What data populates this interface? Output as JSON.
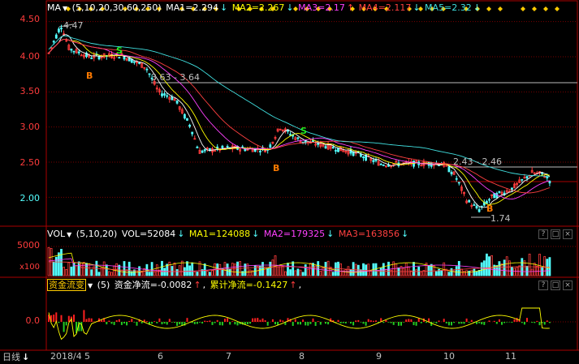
{
  "colors": {
    "up": "#ff3c3c",
    "down": "#54ffff",
    "ma1": "#ffffff",
    "ma2": "#ffff00",
    "ma3": "#ff40ff",
    "ma4": "#ff4040",
    "ma5": "#40e0e0",
    "grid": "#7a0000",
    "axis": "#aa0000",
    "flow_pos": "#ff2020",
    "flow_neg": "#22cc22",
    "flow_line": "#ffff00",
    "marker": "#ffcc00"
  },
  "price_panel": {
    "indicator_name": "MA",
    "params": "(5,10,20,30,60,250)",
    "ma1": {
      "label": "MA1=2.294",
      "arrow": "↓"
    },
    "ma2": {
      "label": "MA2=2.267",
      "arrow": "↓"
    },
    "ma3": {
      "label": "MA3=2.17",
      "arrow": "↑"
    },
    "ma4": {
      "label": "MA4=2.117",
      "arrow": "↓"
    },
    "ma5": {
      "label": "MA5=2.32",
      "arrow": "↓"
    },
    "y_ticks": [
      "4.50",
      "4.00",
      "3.50",
      "3.00",
      "2.50",
      "2.00"
    ],
    "annotations": {
      "high": "4.47",
      "level1": "3.63 - 3.64",
      "level2": "2.43 - 2.46",
      "low": "1.74"
    },
    "signals": {
      "buy": "B",
      "sell": "S"
    }
  },
  "volume_panel": {
    "indicator_name": "VOL",
    "params": "(5,10,20)",
    "vol": {
      "label": "VOL=52084",
      "arrow": "↓"
    },
    "ma1": {
      "label": "MA1=124088",
      "arrow": "↓"
    },
    "ma2": {
      "label": "MA2=179325",
      "arrow": "↓"
    },
    "ma3": {
      "label": "MA3=163856",
      "arrow": "↓"
    },
    "y_tick": "5000",
    "unit": "x100"
  },
  "flow_panel": {
    "indicator_name": "资金流变",
    "params": "(5)",
    "net": {
      "label": "资金净流=-0.0082",
      "arrow": "↑"
    },
    "cum": {
      "label": "累计净流=-0.1427",
      "arrow": "↑"
    },
    "trailing": ",",
    "y_tick": "0.0"
  },
  "x_axis": {
    "period": "日线",
    "labels": [
      "2018/4",
      "5",
      "6",
      "7",
      "8",
      "9",
      "10",
      "11"
    ]
  },
  "controls": {
    "help": "?",
    "maximize": "□",
    "close": "×"
  },
  "chart_data": {
    "type": "line",
    "title": "",
    "xlabel": "",
    "ylabel": "",
    "ylim": [
      1.6,
      4.6
    ],
    "x": [
      "2018/4",
      "5",
      "6",
      "7",
      "8",
      "9",
      "10",
      "11"
    ],
    "series": [
      {
        "name": "MA1",
        "values": [
          4.1,
          4.0,
          3.4,
          2.65,
          2.75,
          2.55,
          2.4,
          2.05,
          2.29
        ]
      },
      {
        "name": "MA5",
        "values": [
          4.15,
          4.05,
          3.6,
          3.05,
          2.85,
          2.6,
          2.47,
          2.4,
          2.32
        ]
      }
    ],
    "annotations": [
      "4.47",
      "3.63 - 3.64",
      "2.43 - 2.46",
      "1.74"
    ]
  }
}
